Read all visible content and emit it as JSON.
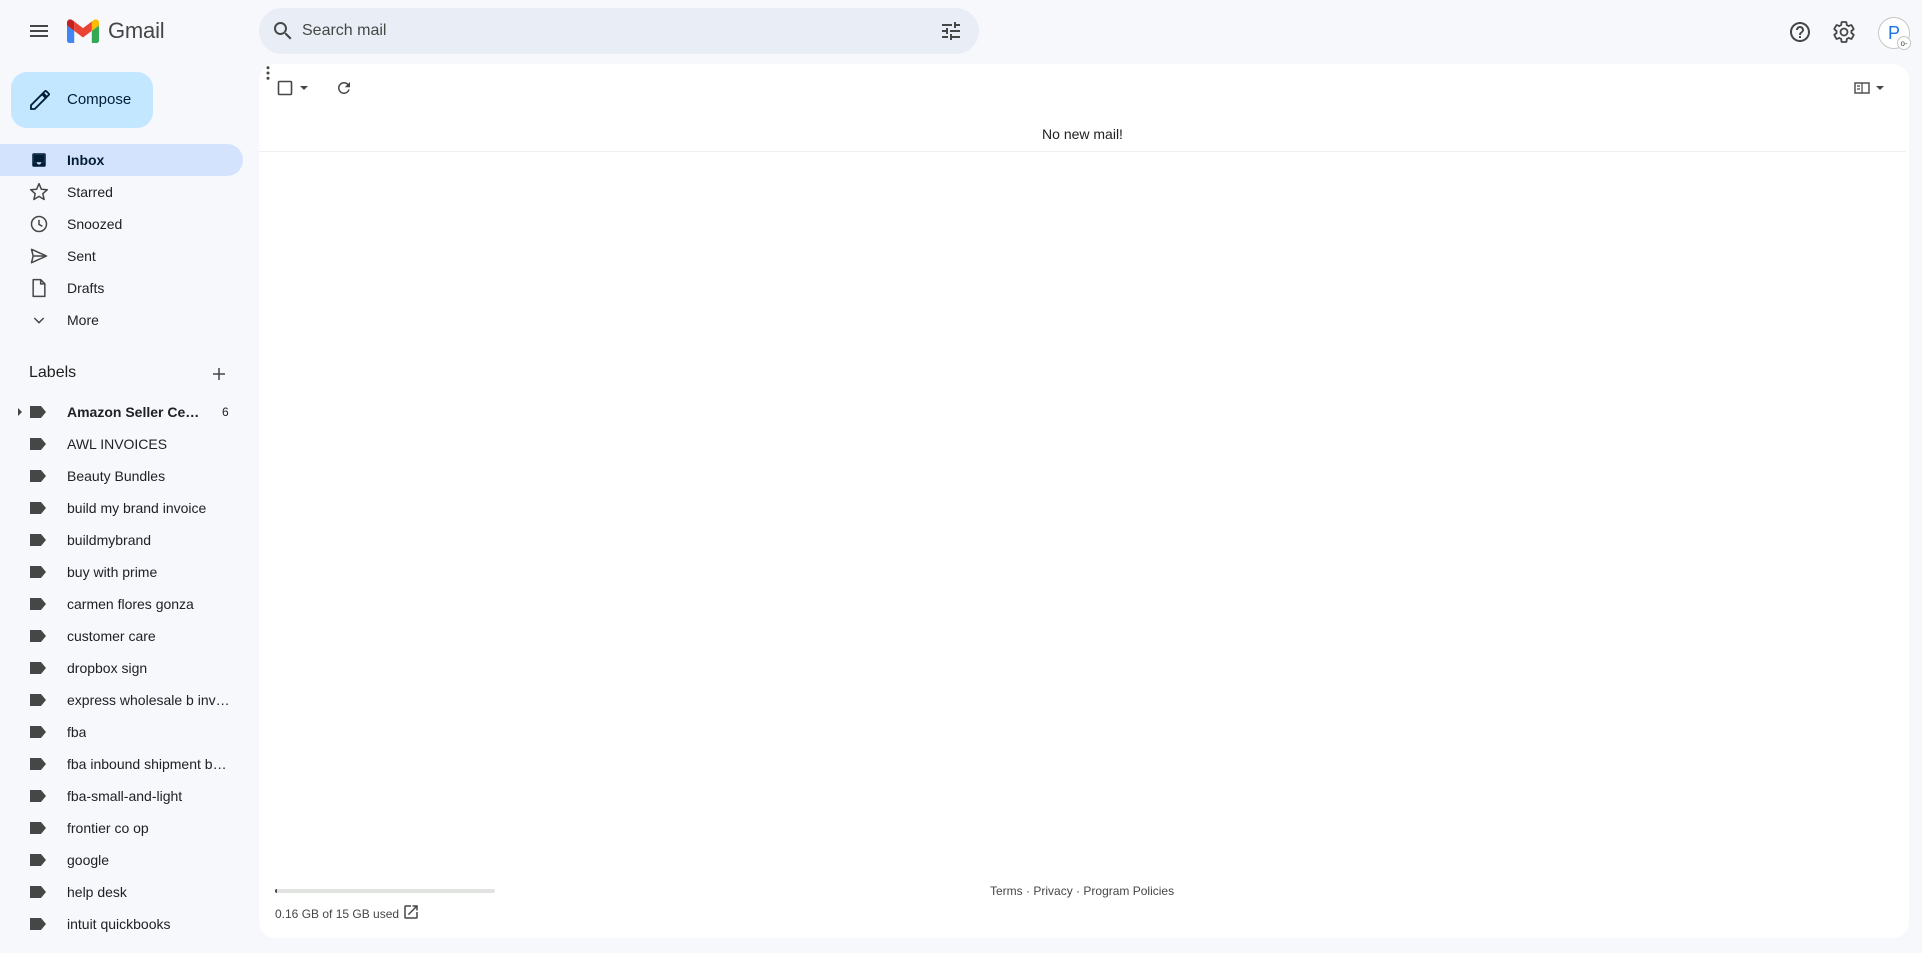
{
  "app": {
    "name": "Gmail"
  },
  "search": {
    "placeholder": "Search mail"
  },
  "avatar": {
    "initial": "P",
    "badge": "o-"
  },
  "compose": {
    "label": "Compose"
  },
  "nav": [
    {
      "label": "Inbox",
      "icon": "inbox-icon",
      "active": true
    },
    {
      "label": "Starred",
      "icon": "star-icon"
    },
    {
      "label": "Snoozed",
      "icon": "clock-icon"
    },
    {
      "label": "Sent",
      "icon": "send-icon"
    },
    {
      "label": "Drafts",
      "icon": "draft-icon"
    },
    {
      "label": "More",
      "icon": "chevron-down-icon"
    }
  ],
  "labels": {
    "title": "Labels",
    "items": [
      {
        "label": "Amazon Seller Central",
        "count": "6",
        "bold": true,
        "expandable": true
      },
      {
        "label": "AWL INVOICES"
      },
      {
        "label": "Beauty Bundles"
      },
      {
        "label": "build my brand invoice"
      },
      {
        "label": "buildmybrand"
      },
      {
        "label": "buy with prime"
      },
      {
        "label": "carmen flores gonza"
      },
      {
        "label": "customer care"
      },
      {
        "label": "dropbox sign"
      },
      {
        "label": "express wholesale b invoices"
      },
      {
        "label": "fba"
      },
      {
        "label": "fba inbound shipment batch"
      },
      {
        "label": "fba-small-and-light"
      },
      {
        "label": "frontier co op"
      },
      {
        "label": "google"
      },
      {
        "label": "help desk"
      },
      {
        "label": "intuit quickbooks"
      }
    ]
  },
  "main": {
    "empty_message": "No new mail!",
    "storage": {
      "text": "0.16 GB of 15 GB used",
      "fraction": 0.0107
    },
    "footer": {
      "terms": "Terms",
      "privacy": "Privacy",
      "policies": "Program Policies",
      "separator": "·"
    }
  },
  "colors": {
    "background": "#f6f8fc",
    "search_bg": "#e9eef6",
    "compose_bg": "#c2e7ff",
    "active_nav_bg": "#d3e3fd",
    "gmail_red": "#ea4335",
    "gmail_blue": "#4285f4",
    "gmail_green": "#34a853",
    "gmail_yellow": "#fbbc04"
  }
}
